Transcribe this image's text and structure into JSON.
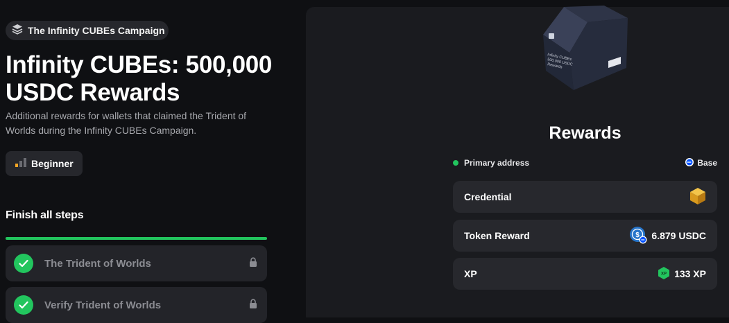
{
  "campaign": {
    "pill_label": "The Infinity CUBEs Campaign",
    "title": "Infinity CUBEs: 500,000 USDC Rewards",
    "description": "Additional rewards for wallets that claimed the Trident of Worlds during the Infinity CUBEs Campaign.",
    "level": "Beginner"
  },
  "steps": {
    "heading": "Finish all steps",
    "progress_percent": 100,
    "items": [
      {
        "label": "The Trident of Worlds",
        "completed": true,
        "locked": true
      },
      {
        "label": "Verify Trident of Worlds",
        "completed": true,
        "locked": true
      }
    ]
  },
  "rewards": {
    "title": "Rewards",
    "address_label": "Primary address",
    "network_label": "Base",
    "rows": [
      {
        "label": "Credential",
        "value": "",
        "icon": "credential-cube-icon"
      },
      {
        "label": "Token Reward",
        "value": "6.879 USDC",
        "icon": "usdc-icon"
      },
      {
        "label": "XP",
        "value": "133 XP",
        "icon": "xp-icon"
      }
    ],
    "xp_badge": "XP"
  },
  "cube_card": {
    "text_lines": [
      "Infinity CUBEs",
      "500,000 USDC",
      "Rewards"
    ]
  },
  "colors": {
    "accent_green": "#22c55e",
    "background": "#0f1013",
    "panel": "#1a1b1f",
    "usdc_blue": "#2775ca",
    "base_blue": "#0052ff"
  }
}
